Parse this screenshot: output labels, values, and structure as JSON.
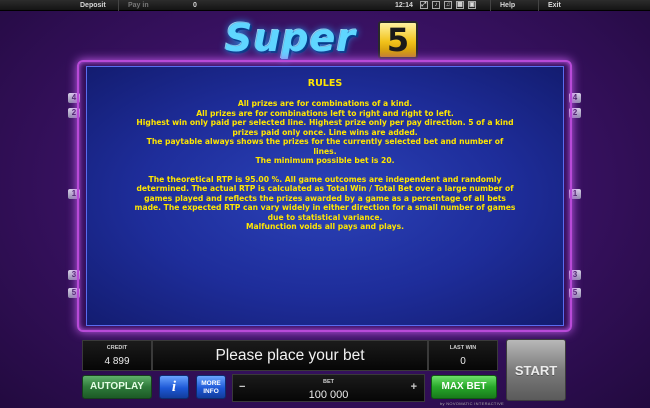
{
  "topbar": {
    "deposit": "Deposit",
    "pay_in": "Pay in",
    "pay_in_value": "0",
    "time": "12:14",
    "icons": [
      "fullscreen-icon",
      "sound-icon",
      "music-icon",
      "settings-icon",
      "screen-icon"
    ],
    "help": "Help",
    "exit": "Exit"
  },
  "logo": {
    "word": "Super",
    "number": "5"
  },
  "markers": {
    "left": [
      "4",
      "2",
      "1",
      "3",
      "5"
    ],
    "right": [
      "4",
      "2",
      "1",
      "3",
      "5"
    ]
  },
  "rules": {
    "title": "RULES",
    "paragraph1": [
      "All prizes are for combinations of a kind.",
      "All prizes are for combinations left to right and right to left.",
      "Highest win only paid per selected line. Highest prize only per pay direction. 5 of a kind",
      "prizes paid only once. Line wins are added.",
      "The paytable always shows the prizes for the currently selected bet and number of",
      "lines.",
      "The minimum possible bet is 20."
    ],
    "paragraph2": [
      "The theoretical RTP is 95.00 %. All game outcomes are independent and randomly",
      "determined. The actual RTP is calculated as Total Win / Total Bet over a large number of",
      "games played and reflects the prizes awarded by a game as a percentage of all bets",
      "made. The expected RTP can vary widely in either direction for a small number of games",
      "due to statistical variance.",
      "Malfunction voids all pays and plays."
    ]
  },
  "bottom": {
    "credit_label": "CREDIT",
    "credit_value": "4 899",
    "message": "Please place your bet",
    "last_win_label": "LAST WIN",
    "last_win_value": "0",
    "start": "START",
    "autoplay": "AUTOPLAY",
    "info": "i",
    "more_info_line1": "MORE",
    "more_info_line2": "INFO",
    "bet_label": "BET",
    "bet_value": "100 000",
    "bet_minus": "−",
    "bet_plus": "+",
    "max_bet": "MAX BET",
    "brand": "by NOVOMATIC INTERACTIVE"
  },
  "colors": {
    "rules_text": "#ffe600",
    "panel_blue": "#1e2d9a",
    "frame_purple": "#b84ad8",
    "background": "#3b1266"
  }
}
